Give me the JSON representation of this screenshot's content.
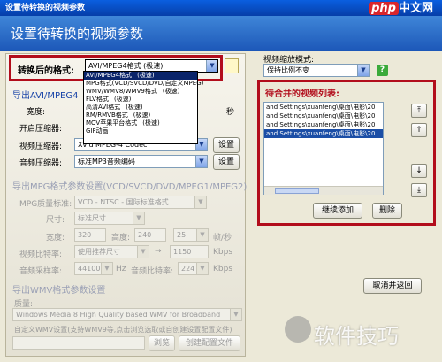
{
  "window": {
    "title": "设置待转换的视频参数",
    "banner": "设置待转换的视频参数"
  },
  "brand": {
    "red": "php",
    "rest": "中文网"
  },
  "output_format": {
    "label": "转换后的格式:",
    "value": "AVI/MPEG4格式       (极速)",
    "dropdown": [
      {
        "name": "AVI/MPEG4格式",
        "tag": "(极速)",
        "selected": true
      },
      {
        "name": "MPG格式(VCD/SVCD/DVD/自定义MPEG)",
        "tag": "",
        "selected": false
      },
      {
        "name": "WMV/WMV8/WMV9格式",
        "tag": "(极速)",
        "selected": false
      },
      {
        "name": "FLV格式",
        "tag": "(极速)",
        "selected": false
      },
      {
        "name": "高清AVI格式",
        "tag": "(极速)",
        "selected": false
      },
      {
        "name": "RM/RMVB格式",
        "tag": "(极速)",
        "selected": false
      },
      {
        "name": "MOV苹果平台格式",
        "tag": "(极速)",
        "selected": false
      },
      {
        "name": "GIF动画",
        "tag": "",
        "selected": false
      }
    ]
  },
  "avi_section": {
    "title": "导出AVI/MPEG4",
    "width_label": "宽度:",
    "open_label": "开启压缩器:",
    "frame_unit": "秒",
    "video_compressor_label": "视频压缩器:",
    "video_compressor_value": "Xvid MPEG-4 Codec",
    "audio_compressor_label": "音频压缩器:",
    "audio_compressor_value": "标准MP3音频编码",
    "settings_button": "设置"
  },
  "mpg_section": {
    "title": "导出MPG格式参数设置(VCD/SVCD/DVD/MPEG1/MPEG2)",
    "quality_label": "MPG质量标准:",
    "quality_value": "VCD - NTSC - 国际标准格式",
    "size_label": "尺寸:",
    "size_value": "标准尺寸",
    "width_label": "宽度:",
    "width_value": "320",
    "height_label": "高度:",
    "height_value": "240",
    "fps_value": "25",
    "fps_unit": "帧/秒",
    "video_bitrate_label": "视频比特率:",
    "video_bitrate_value": "使用推荐尺寸",
    "video_bitrate_num": "1150",
    "kbps": "Kbps",
    "audio_rate_label": "音频采样率:",
    "audio_rate_value": "44100",
    "hz": "Hz",
    "audio_bitrate_label": "音频比特率:",
    "audio_bitrate_value": "224"
  },
  "wmv_section": {
    "title": "导出WMV格式参数设置",
    "quality_label": "质量:",
    "quality_value": "Windows Media 8 High Quality based WMV for Broadband",
    "custom_label": "自定义WMV设置(支持WMV9等,点击浏览选取或自创建设置配置文件)",
    "browse_button": "浏览",
    "create_button": "创建配置文件"
  },
  "right": {
    "scale_label": "视频缩放模式:",
    "scale_value": "保持比例不变",
    "list_title": "待合并的视频列表:",
    "list_items": [
      "and Settings\\xuanfeng\\桌面\\电影\\20",
      "and Settings\\xuanfeng\\桌面\\电影\\20",
      "and Settings\\xuanfeng\\桌面\\电影\\20",
      "and Settings\\xuanfeng\\桌面\\电影\\20"
    ],
    "add_button": "继续添加",
    "delete_button": "删除",
    "cancel_button": "取消并返回"
  },
  "watermark": "软件技巧"
}
